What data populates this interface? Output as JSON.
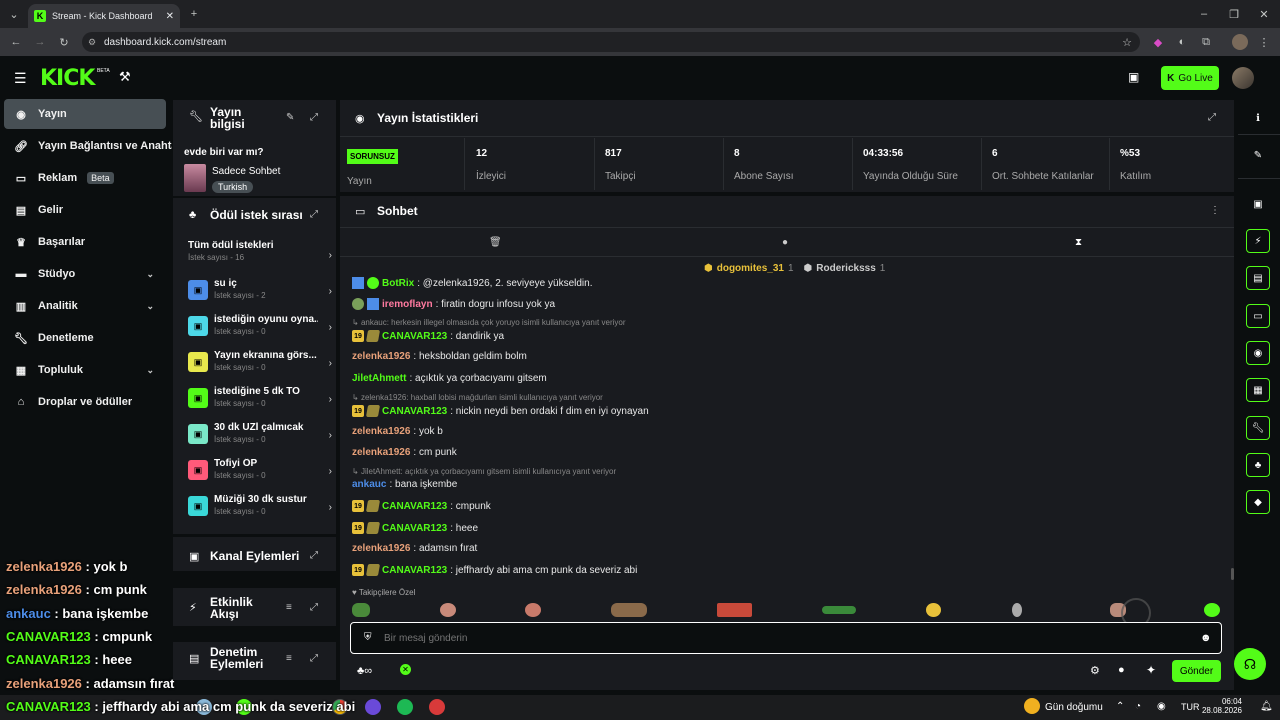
{
  "browser": {
    "tab_title": "Stream - Kick Dashboard",
    "url": "dashboard.kick.com/stream",
    "favicon_letter": "K"
  },
  "header": {
    "logo": "KICK",
    "logo_badge": "BETA",
    "go_live": "Go Live"
  },
  "sidebar": {
    "items": [
      {
        "label": "Yayın",
        "icon": "play-circle-icon"
      },
      {
        "label": "Yayın Bağlantısı ve Anahtarı",
        "icon": "link-icon"
      },
      {
        "label": "Reklam",
        "icon": "ad-icon",
        "badge": "Beta"
      },
      {
        "label": "Gelir",
        "icon": "money-icon"
      },
      {
        "label": "Başarılar",
        "icon": "trophy-icon"
      },
      {
        "label": "Stüdyo",
        "icon": "studio-icon"
      },
      {
        "label": "Analitik",
        "icon": "analytics-icon"
      },
      {
        "label": "Denetleme",
        "icon": "wrench-icon"
      },
      {
        "label": "Topluluk",
        "icon": "community-icon"
      },
      {
        "label": "Droplar ve ödüller",
        "icon": "gift-icon"
      }
    ]
  },
  "stream_info": {
    "title": "Yayın bilgisi",
    "stream_title": "evde biri var mı?",
    "category": "Sadece Sohbet",
    "language": "Turkish"
  },
  "rewards": {
    "title": "Ödül istek sırası",
    "all_label": "Tüm ödül istekleri",
    "all_count": "İstek sayısı - 16",
    "items": [
      {
        "name": "su iç",
        "count": "İstek sayısı - 2",
        "color": "#4d8de8"
      },
      {
        "name": "istediğin oyunu oyna...",
        "count": "İstek sayısı - 0",
        "color": "#4dd8e8"
      },
      {
        "name": "Yayın ekranına görs...",
        "count": "İstek sayısı - 0",
        "color": "#e8e84d"
      },
      {
        "name": "istediğine 5 dk TO",
        "count": "İstek sayısı - 0",
        "color": "#53fc18"
      },
      {
        "name": "30 dk UZİ çalmıcak",
        "count": "İstek sayısı - 0",
        "color": "#7ae8c8"
      },
      {
        "name": "Tofiyi ÖP",
        "count": "İstek sayısı - 0",
        "color": "#ff5a7a"
      },
      {
        "name": "Müziği 30 dk sustur",
        "count": "İstek sayısı - 0",
        "color": "#3ad8d8"
      }
    ]
  },
  "panels": {
    "channel_actions": "Kanal Eylemleri",
    "activity_feed": "Etkinlik Akışı",
    "mod_actions": "Denetim Eylemleri"
  },
  "stats": {
    "title": "Yayın İstatistikleri",
    "items": [
      {
        "value": "SORUNSUZ",
        "label": "Yayın"
      },
      {
        "value": "12",
        "label": "İzleyici"
      },
      {
        "value": "817",
        "label": "Takipçi"
      },
      {
        "value": "8",
        "label": "Abone Sayısı"
      },
      {
        "value": "04:33:56",
        "label": "Yayında Olduğu Süre"
      },
      {
        "value": "6",
        "label": "Ort. Sohbete Katılanlar"
      },
      {
        "value": "%53",
        "label": "Katılım"
      }
    ]
  },
  "chat": {
    "title": "Sohbet",
    "gifters": [
      {
        "name": "dogomites_31",
        "count": "1"
      },
      {
        "name": "Rodericksss",
        "count": "1"
      }
    ],
    "messages": [
      {
        "user": "BotRix",
        "text": ": @zelenka1926, 2. seviyeye yükseldin."
      },
      {
        "user": "iremoflayn",
        "text": ": firatin dogru infosu yok ya"
      },
      {
        "reply": "ankauc: herkesin illegel olmasıda çok yoruyo isimli kullanıcıya yanıt veriyor"
      },
      {
        "user": "CANAVAR123",
        "text": ": dandirik ya"
      },
      {
        "user": "zelenka1926",
        "text": ": heksboldan geldim bolm"
      },
      {
        "user": "JiletAhmett",
        "text": ": açıktık ya çorbacıyamı gitsem"
      },
      {
        "reply": "zelenka1926: haxball lobisi mağdurları isimli kullanıcıya yanıt veriyor"
      },
      {
        "user": "CANAVAR123",
        "text": ": nickin neydi ben ordaki f dim en iyi oynayan"
      },
      {
        "user": "zelenka1926",
        "text": ": yok b"
      },
      {
        "user": "zelenka1926",
        "text": ": cm punk"
      },
      {
        "reply": "JiletAhmett: açıktık ya çorbacıyamı gitsem isimli kullanıcıya yanıt veriyor"
      },
      {
        "user": "ankauc",
        "text": ": bana işkembe"
      },
      {
        "user": "CANAVAR123",
        "text": ": cmpunk"
      },
      {
        "user": "CANAVAR123",
        "text": ": heee"
      },
      {
        "user": "zelenka1926",
        "text": ": adamsın fırat"
      },
      {
        "user": "CANAVAR123",
        "text": ": jeffhardy abi ama cm punk da severiz abi"
      }
    ],
    "sub_badge": "19",
    "followers_only": "Takipçilere Özel",
    "placeholder": "Bir mesaj gönderin",
    "send": "Gönder"
  },
  "overlay": {
    "lines": [
      {
        "user": "zelenka1926",
        "text": " : yok b"
      },
      {
        "user": "zelenka1926",
        "text": " : cm punk"
      },
      {
        "user": "ankauc",
        "text": " : bana işkembe"
      },
      {
        "user": "CANAVAR123",
        "text": " : cmpunk"
      },
      {
        "user": "CANAVAR123",
        "text": " : heee"
      },
      {
        "user": "zelenka1926",
        "text": " : adamsın fırat"
      },
      {
        "user": "CANAVAR123",
        "text": " : jeffhardy abi ama cm punk da severiz abi"
      }
    ]
  },
  "taskbar": {
    "weather": "Gün doğumu",
    "lang": "TUR",
    "time": "06:04",
    "date": "28.08.2026"
  }
}
